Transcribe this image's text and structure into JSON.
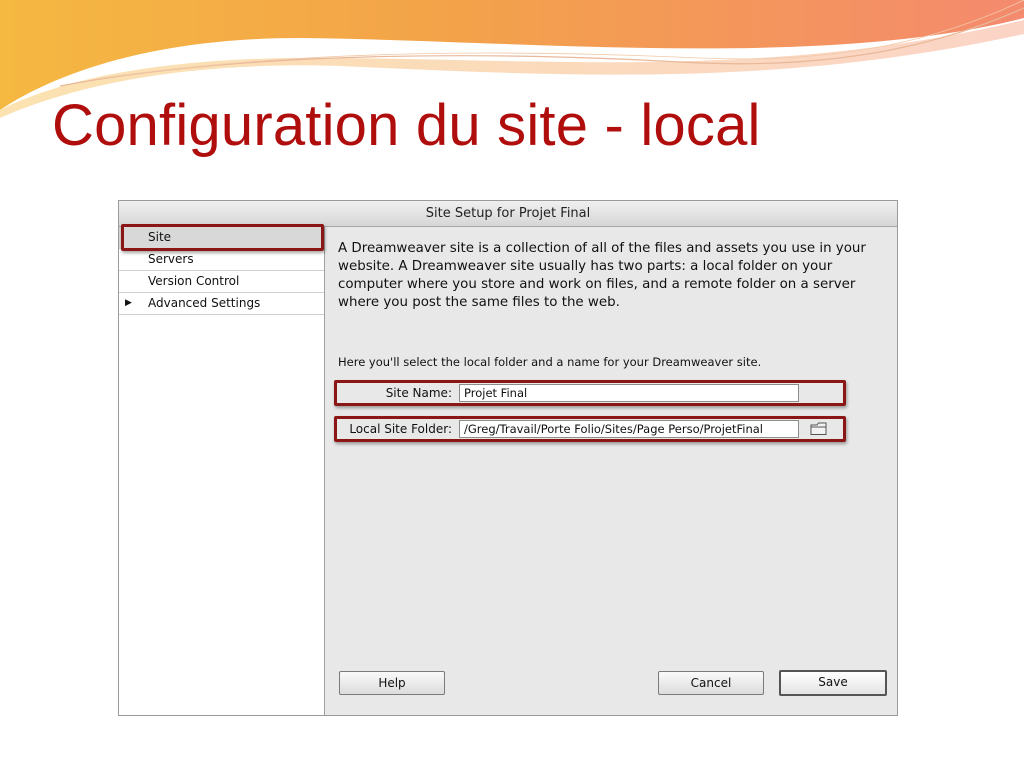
{
  "slide": {
    "title": "Configuration du site - local",
    "accent": "#b00d0d"
  },
  "dialog": {
    "title": "Site Setup for Projet Final",
    "sidebar": {
      "items": [
        {
          "label": "Site",
          "selected": true
        },
        {
          "label": "Servers"
        },
        {
          "label": "Version Control"
        },
        {
          "label": "Advanced Settings",
          "expandable": true,
          "icon": "triangle-right-icon"
        }
      ]
    },
    "intro": "A Dreamweaver site is a collection of all of the files and assets you use in your website. A Dreamweaver site usually has two parts: a local folder on your computer where you store and work on files, and a remote folder on a server where you post the same files to the web.",
    "instruction": "Here you'll select the local folder and a name for your Dreamweaver site.",
    "site_name": {
      "label": "Site Name:",
      "value": "Projet Final"
    },
    "local_folder": {
      "label": "Local Site Folder:",
      "value": "/Greg/Travail/Porte Folio/Sites/Page Perso/ProjetFinal",
      "icon": "folder-icon"
    },
    "buttons": {
      "help": "Help",
      "cancel": "Cancel",
      "save": "Save"
    },
    "highlight_color": "#8b1616"
  }
}
